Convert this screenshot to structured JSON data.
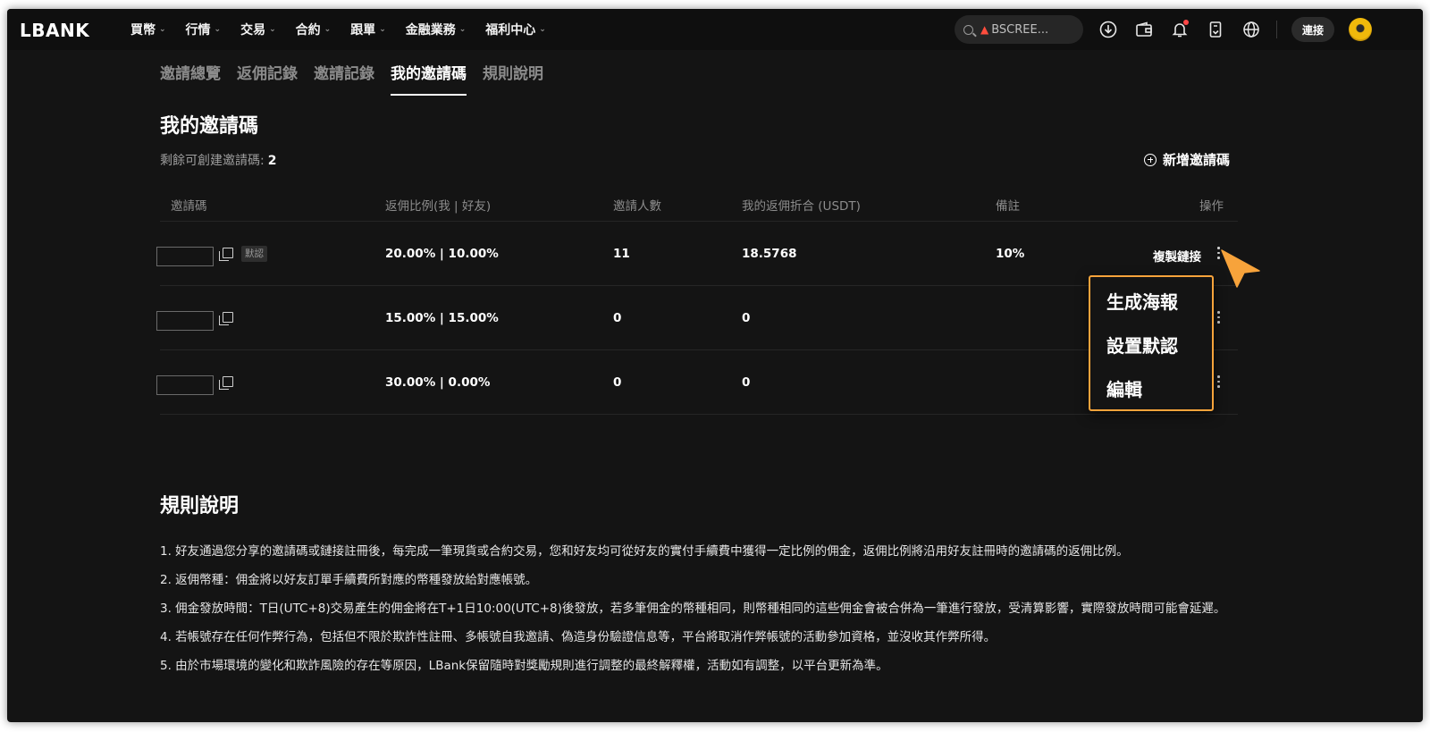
{
  "nav": {
    "logo": "LBANK",
    "menu": [
      "買幣",
      "行情",
      "交易",
      "合約",
      "跟單",
      "金融業務",
      "福利中心"
    ],
    "search_text": "BSCREE...",
    "connect_label": "連接"
  },
  "tabs": [
    "邀請總覽",
    "返佣記錄",
    "邀請記錄",
    "我的邀請碼",
    "規則說明"
  ],
  "active_tab": "我的邀請碼",
  "section": {
    "title": "我的邀請碼",
    "remaining_label": "剩餘可創建邀請碼:",
    "remaining_value": "2",
    "add_code_label": "新增邀請碼"
  },
  "table": {
    "headers": {
      "code": "邀請碼",
      "ratio": "返佣比例(我 | 好友)",
      "invited": "邀請人數",
      "rebate": "我的返佣折合 (USDT)",
      "note": "備註",
      "action": "操作"
    },
    "rows": [
      {
        "default_badge": "默認",
        "ratio": "20.00% | 10.00%",
        "invited": "11",
        "rebate": "18.5768",
        "note": "10%",
        "copy_link": "複製鏈接"
      },
      {
        "ratio": "15.00% | 15.00%",
        "invited": "0",
        "rebate": "0",
        "note": "",
        "copy_link": ""
      },
      {
        "ratio": "30.00% | 0.00%",
        "invited": "0",
        "rebate": "0",
        "note": "",
        "copy_link": ""
      }
    ]
  },
  "dropdown": {
    "items": [
      "生成海報",
      "設置默認",
      "編輯"
    ],
    "highlight_color": "#f7a33b"
  },
  "rules": {
    "title": "規則說明",
    "items": [
      "1. 好友通過您分享的邀請碼或鏈接註冊後，每完成一筆現貨或合約交易，您和好友均可從好友的實付手續費中獲得一定比例的佣金，返佣比例將沿用好友註冊時的邀請碼的返佣比例。",
      "2. 返佣幣種：佣金將以好友訂單手續費所對應的幣種發放給對應帳號。",
      "3. 佣金發放時間：T日(UTC+8)交易產生的佣金將在T+1日10:00(UTC+8)後發放，若多筆佣金的幣種相同，則幣種相同的這些佣金會被合併為一筆進行發放，受清算影響，實際發放時間可能會延遲。",
      "4. 若帳號存在任何作弊行為，包括但不限於欺詐性註冊、多帳號自我邀請、偽造身份驗證信息等，平台將取消作弊帳號的活動參加資格，並沒收其作弊所得。",
      "5. 由於市場環境的變化和欺詐風險的存在等原因，LBank保留隨時對獎勵規則進行調整的最終解釋權，活動如有調整，以平台更新為準。"
    ]
  },
  "colors": {
    "background": "#141414",
    "accent_orange": "#f7a33b",
    "notification_dot": "#ff4747",
    "avatar_gold": "#f0b90b"
  }
}
